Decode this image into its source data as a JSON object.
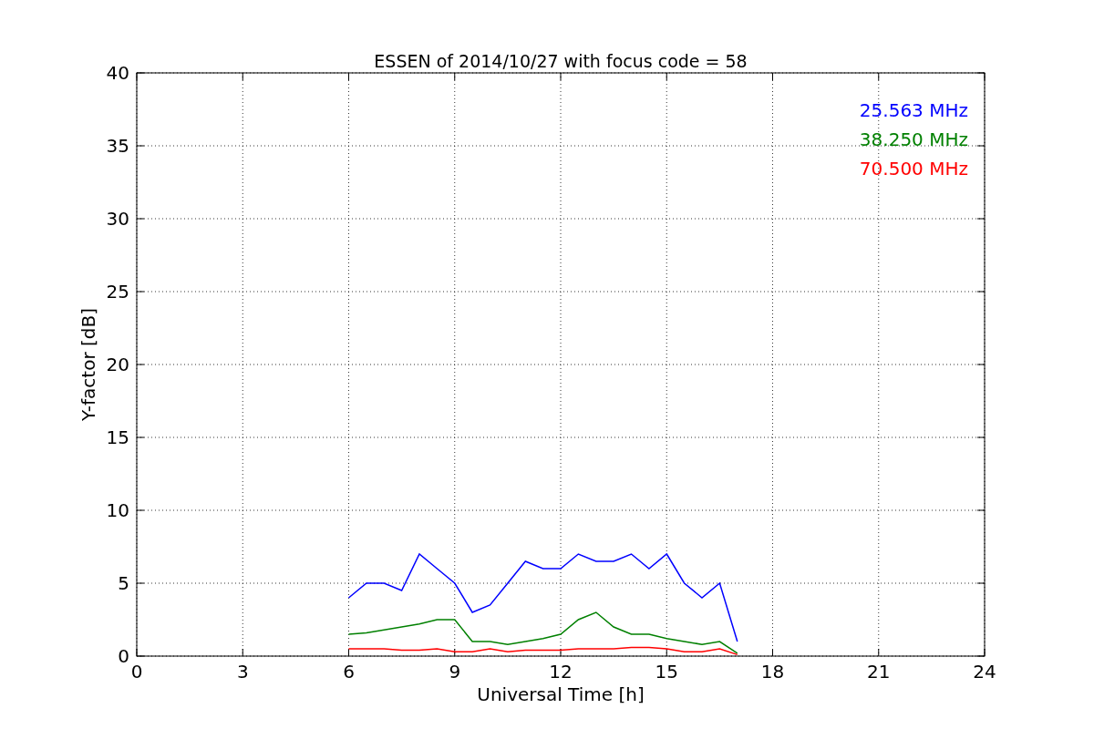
{
  "chart_data": {
    "type": "line",
    "title": "ESSEN of 2014/10/27 with focus code = 58",
    "xlabel": "Universal Time [h]",
    "ylabel": "Y-factor [dB]",
    "x": [
      6,
      6.5,
      7,
      7.5,
      8,
      8.5,
      9,
      9.5,
      10,
      10.5,
      11,
      11.5,
      12,
      12.5,
      13,
      13.5,
      14,
      14.5,
      15,
      15.5,
      16,
      16.5,
      17
    ],
    "series": [
      {
        "name": "25.563 MHz",
        "color": "#0000ff",
        "values": [
          4,
          5,
          5,
          4.5,
          7,
          6,
          5,
          3,
          3.5,
          5,
          6.5,
          6,
          6,
          7,
          6.5,
          6.5,
          7,
          6,
          7,
          5,
          4,
          5,
          1
        ]
      },
      {
        "name": "38.250 MHz",
        "color": "#008000",
        "values": [
          1.5,
          1.6,
          1.8,
          2,
          2.2,
          2.5,
          2.5,
          1,
          1,
          0.8,
          1,
          1.2,
          1.5,
          2.5,
          3,
          2,
          1.5,
          1.5,
          1.2,
          1,
          0.8,
          1,
          0.2
        ]
      },
      {
        "name": "70.500 MHz",
        "color": "#ff0000",
        "values": [
          0.5,
          0.5,
          0.5,
          0.4,
          0.4,
          0.5,
          0.3,
          0.3,
          0.5,
          0.3,
          0.4,
          0.4,
          0.4,
          0.5,
          0.5,
          0.5,
          0.6,
          0.6,
          0.5,
          0.3,
          0.3,
          0.5,
          0.1
        ]
      }
    ],
    "grid": true,
    "xlim": [
      0,
      24
    ],
    "ylim": [
      0,
      40
    ],
    "xticks": [
      0,
      3,
      6,
      9,
      12,
      15,
      18,
      21,
      24
    ],
    "yticks": [
      0,
      5,
      10,
      15,
      20,
      25,
      30,
      35,
      40
    ]
  }
}
